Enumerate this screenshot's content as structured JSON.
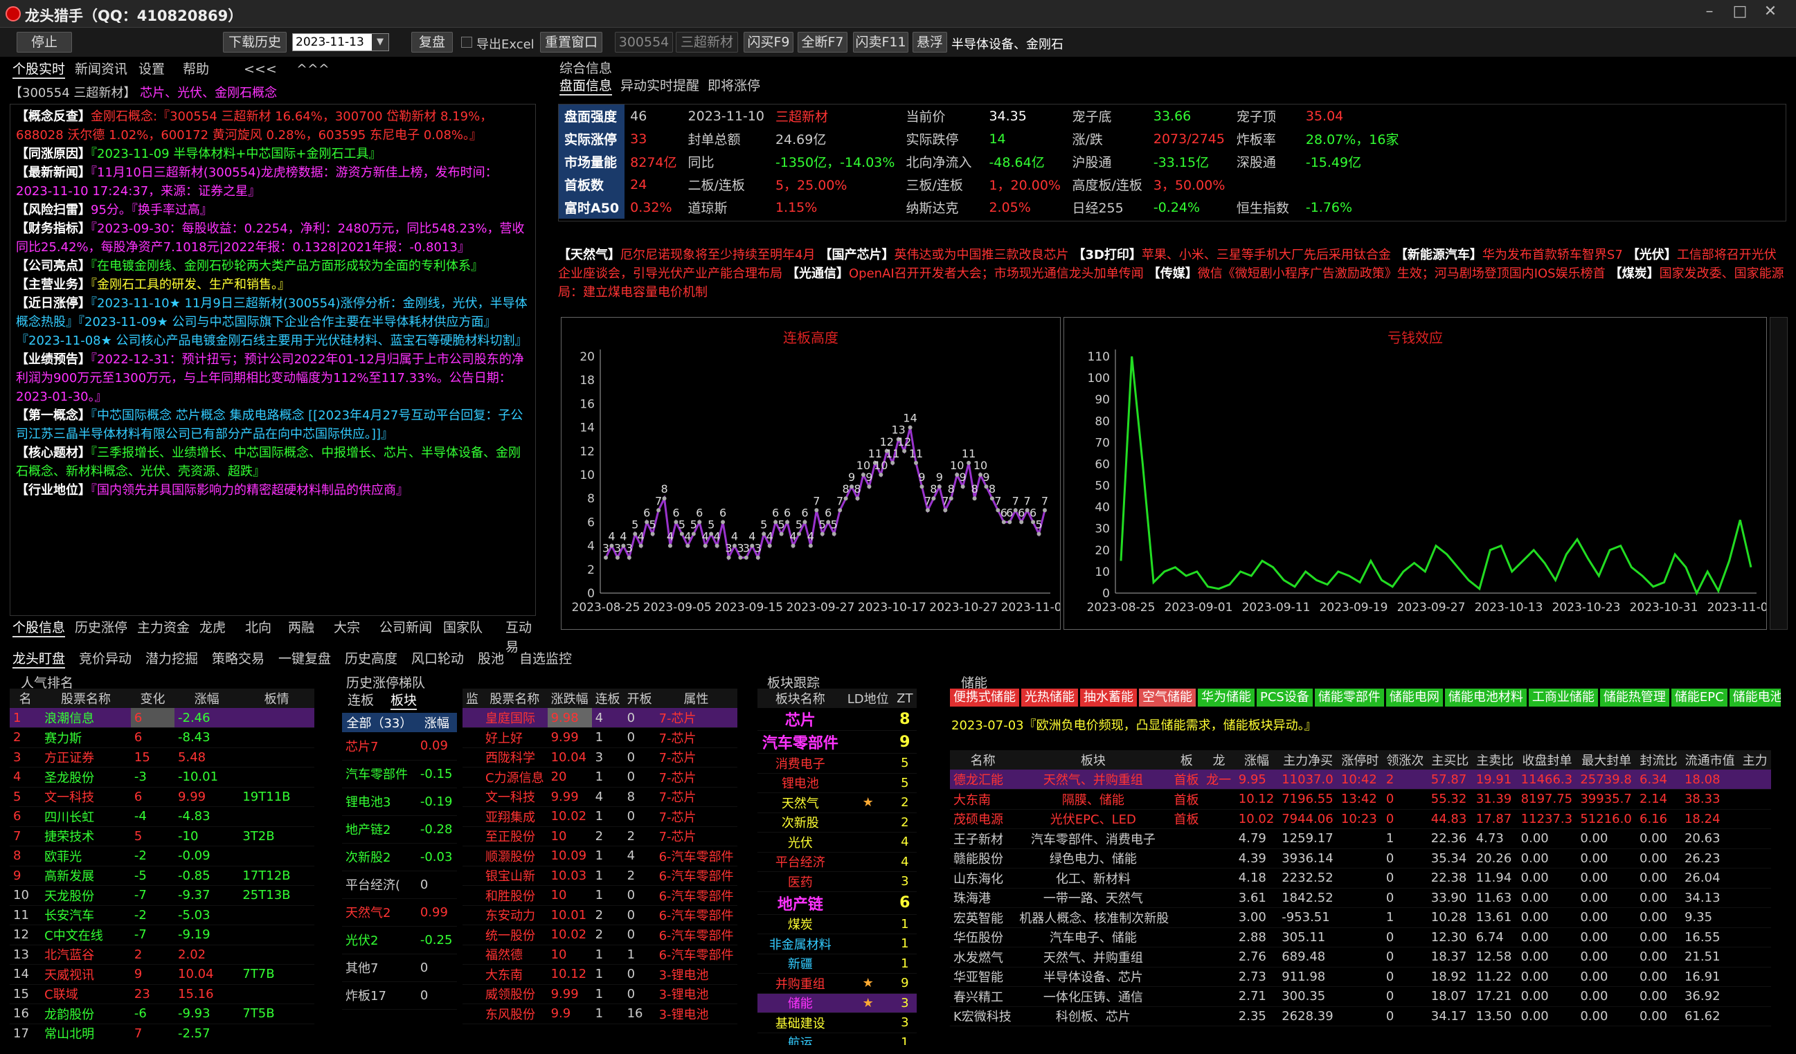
{
  "window": {
    "title": "龙头猎手（QQ：410820869）",
    "min": "–",
    "max": "□",
    "close": "✕"
  },
  "toolbar": {
    "stop": "停止",
    "download": "下载历史",
    "date": "2023-11-13",
    "replay": "复盘",
    "export": "导出Excel",
    "reset": "重置窗口",
    "code": "300554",
    "name": "三超新材",
    "flash_buy": "闪买F9",
    "full_sell": "全断F7",
    "flash_sell": "闪卖F11",
    "float": "悬浮",
    "concept": "半导体设备、金刚石"
  },
  "left_tabs": [
    "个股实时",
    "新闻资讯",
    "设置",
    "帮助",
    "<<<",
    "^^^"
  ],
  "stock_header": {
    "code_name": "【300554 三超新材】",
    "tags": "芯片、光伏、金刚石概念"
  },
  "info_lines": [
    {
      "label": "【概念反查】",
      "text": "金刚石概念:『300554 三超新材 16.64%，300700 岱勒新材 8.19%，688028 沃尔德 1.02%，600172 黄河旋风 0.28%，603595 东尼电子 0.08%。』",
      "cls": "r"
    },
    {
      "label": "【同涨原因】",
      "text": "『2023-11-09 半导体材料+中芯国际+金刚石工具』",
      "cls": "g"
    },
    {
      "label": "【最新新闻】",
      "text": "『11月10日三超新材(300554)龙虎榜数据：游资方新佳上榜，发布时间：2023-11-10 17:24:37，来源：证券之星』",
      "cls": "m"
    },
    {
      "label": "【风险扫雷】",
      "text": "95分。『换手率过高』",
      "cls": "m"
    },
    {
      "label": "【财务指标】",
      "text": "『2023-09-30：每股收益：0.2254，净利：2480万元，同比548.23%，营收同比25.42%，每股净资产7.1018元|2022年报：0.1328|2021年报：-0.8013』",
      "cls": "m"
    },
    {
      "label": "【公司亮点】",
      "text": "『在电镀金刚线、金刚石砂轮两大类产品方面形成较为全面的专利体系』",
      "cls": "g"
    },
    {
      "label": "【主营业务】",
      "text": "『金刚石工具的研发、生产和销售。』",
      "cls": "y"
    },
    {
      "label": "【近日涨停】",
      "text": "『2023-11-10★ 11月9日三超新材(300554)涨停分析：金刚线，光伏，半导体概念热股』『2023-11-09★ 公司与中芯国际旗下企业合作主要在半导体耗材供应方面』『2023-11-08★ 公司核心产品电镀金刚石线主要用于光伏硅材料、蓝宝石等硬脆材料切割』",
      "cls": "c"
    },
    {
      "label": "【业绩预告】",
      "text": "『2022-12-31：预计扭亏；预计公司2022年01-12月归属于上市公司股东的净利润为900万元至1300万元，与上年同期相比变动幅度为112%至117.33%。公告日期：2023-01-30。』",
      "cls": "m"
    },
    {
      "label": "【第一概念】",
      "text": "『中芯国际概念 芯片概念 集成电路概念 [[2023年4月27号互动平台回复：子公司江苏三晶半导体材料有限公司已有部分产品在向中芯国际供应。]]』",
      "cls": "c"
    },
    {
      "label": "【核心题材】",
      "text": "『三季报增长、业绩增长、中芯国际概念、中报增长、芯片、半导体设备、金刚石概念、新材料概念、光伏、壳资源、超跌』",
      "cls": "g"
    },
    {
      "label": "【行业地位】",
      "text": "『国内领先并具国际影响力的精密超硬材料制品的供应商』",
      "cls": "m"
    }
  ],
  "left_bottom_tabs": [
    "个股信息",
    "历史涨停",
    "主力资金",
    "龙虎",
    "北向",
    "两融",
    "大宗",
    "公司新闻",
    "国家队",
    "互动易"
  ],
  "summary": {
    "title": "综合信息",
    "tabs": [
      "盘面信息",
      "异动实时提醒",
      "即将涨停"
    ]
  },
  "market": [
    [
      "盘面强度",
      "46",
      "2023-11-10",
      "三超新材",
      "当前价",
      "34.35",
      "宠子底",
      "33.66",
      "宠子顶",
      "35.04"
    ],
    [
      "实际涨停",
      "33",
      "封单总额",
      "24.69亿",
      "实际跌停",
      "14",
      "涨/跌",
      "2073/2745",
      "炸板率",
      "28.07%，16家"
    ],
    [
      "市场量能",
      "8274亿",
      "同比",
      "-1350亿，-14.03%",
      "北向净流入",
      "-48.64亿",
      "沪股通",
      "-33.15亿",
      "深股通",
      "-15.49亿"
    ],
    [
      "首板数",
      "24",
      "二板/连板",
      "5，25.00%",
      "三板/连板",
      "1，20.00%",
      "高度板/连板",
      "3，50.00%",
      "",
      ""
    ],
    [
      "富时A50",
      "0.32%",
      "道琼斯",
      "1.15%",
      "纳斯达克",
      "2.05%",
      "日经255",
      "-0.24%",
      "恒生指数",
      "-1.76%"
    ]
  ],
  "news": [
    {
      "k": "【天然气】",
      "v": "厄尔尼诺现象将至少持续至明年4月"
    },
    {
      "k": "【国产芯片】",
      "v": "英伟达或为中国推三款改良芯片"
    },
    {
      "k": "【3D打印】",
      "v": "苹果、小米、三星等手机大厂先后采用钛合金"
    },
    {
      "k": "【新能源汽车】",
      "v": "华为发布首款轿车智界S7"
    },
    {
      "k": "【光伏】",
      "v": "工信部将召开光伏企业座谈会，引导光伏产业产能合理布局"
    },
    {
      "k": "【光通信】",
      "v": "OpenAI召开开发者大会；市场现光通信龙头加单传闻"
    },
    {
      "k": "【传媒】",
      "v": "微信《微短剧小程序广告激励政策》生效；河马剧场登顶国内IOS娱乐榜首"
    },
    {
      "k": "【煤炭】",
      "v": "国家发改委、国家能源局：建立煤电容量电价机制"
    }
  ],
  "chart_data": [
    {
      "type": "line",
      "title": "连板高度",
      "x": [
        "2023-08-25",
        "2023-08-26",
        "2023-08-27",
        "2023-08-28",
        "2023-08-29",
        "2023-08-30",
        "2023-08-31",
        "2023-09-01",
        "2023-09-02",
        "2023-09-03",
        "2023-09-04",
        "2023-09-05",
        "2023-09-06",
        "2023-09-07",
        "2023-09-08",
        "2023-09-09",
        "2023-09-10",
        "2023-09-11",
        "2023-09-12",
        "2023-09-13",
        "2023-09-14",
        "2023-09-15",
        "2023-09-16",
        "2023-09-17",
        "2023-09-18",
        "2023-09-19",
        "2023-09-20",
        "2023-09-21",
        "2023-09-22",
        "2023-09-23",
        "2023-09-24",
        "2023-09-25",
        "2023-09-26",
        "2023-09-27",
        "2023-09-28",
        "2023-09-29",
        "2023-09-30",
        "2023-10-01",
        "2023-10-02",
        "2023-10-03",
        "2023-10-04",
        "2023-10-05",
        "2023-10-06",
        "2023-10-07",
        "2023-10-08",
        "2023-10-09",
        "2023-10-10",
        "2023-10-11",
        "2023-10-12",
        "2023-10-13",
        "2023-10-14",
        "2023-10-15",
        "2023-10-16",
        "2023-10-17",
        "2023-10-18",
        "2023-10-19",
        "2023-10-20",
        "2023-10-21",
        "2023-10-22",
        "2023-10-23",
        "2023-10-24",
        "2023-10-25",
        "2023-10-26",
        "2023-10-27",
        "2023-10-28",
        "2023-10-29",
        "2023-10-30",
        "2023-10-31",
        "2023-11-01",
        "2023-11-02",
        "2023-11-03",
        "2023-11-04",
        "2023-11-05",
        "2023-11-06",
        "2023-11-07",
        "2023-11-08"
      ],
      "values": [
        3,
        4,
        3,
        4,
        3,
        5,
        4,
        6,
        5,
        7,
        8,
        4,
        6,
        5,
        4,
        5,
        6,
        4,
        5,
        4,
        6,
        3,
        4,
        3,
        3,
        4,
        3,
        5,
        4,
        6,
        5,
        6,
        4,
        5,
        6,
        4,
        7,
        5,
        6,
        5,
        7,
        8,
        9,
        8,
        10,
        9,
        11,
        10,
        12,
        11,
        13,
        12,
        14,
        11,
        9,
        7,
        8,
        9,
        7,
        8,
        10,
        9,
        11,
        8,
        10,
        9,
        8,
        7,
        6,
        6,
        7,
        6,
        7,
        6,
        5,
        7
      ],
      "labels": [
        "3",
        "4",
        "3",
        "4",
        "3",
        "5",
        "4",
        "6",
        "5",
        "7",
        "8",
        "4",
        "6",
        "5",
        "4",
        "5",
        "6",
        "4",
        "5",
        "4",
        "6",
        "3",
        "4",
        "3",
        "3",
        "4",
        "3",
        "5",
        "4",
        "6",
        "5",
        "6",
        "4",
        "5",
        "6",
        "4",
        "7",
        "5",
        "6",
        "5",
        "7",
        "8",
        "9",
        "8",
        "10",
        "9",
        "11",
        "10",
        "12",
        "11",
        "13",
        "12",
        "14",
        "11",
        "9",
        "7",
        "8",
        "9",
        "7",
        "8",
        "10",
        "9",
        "11",
        "8",
        "10",
        "9",
        "8",
        "7",
        "6",
        "6",
        "7",
        "6",
        "7",
        "6",
        "5",
        "7"
      ],
      "ylim": [
        0,
        20
      ],
      "yticks": [
        "0",
        "2",
        "4",
        "6",
        "8",
        "10",
        "12",
        "14",
        "16",
        "18",
        "20"
      ],
      "xticks": [
        "2023-08-25",
        "2023-09-05",
        "2023-09-15",
        "2023-09-27",
        "2023-10-17",
        "2023-10-27",
        "2023-11-08"
      ],
      "color": "#9933cc"
    },
    {
      "type": "line",
      "title": "亏钱效应",
      "values": [
        15,
        110,
        60,
        5,
        10,
        12,
        8,
        10,
        3,
        2,
        4,
        10,
        8,
        15,
        12,
        6,
        3,
        10,
        6,
        4,
        10,
        8,
        5,
        15,
        6,
        3,
        10,
        14,
        10,
        22,
        18,
        12,
        6,
        2,
        20,
        22,
        10,
        15,
        20,
        14,
        6,
        18,
        25,
        16,
        8,
        20,
        22,
        12,
        8,
        3,
        5,
        18,
        12,
        0,
        10,
        1,
        15,
        34,
        12
      ],
      "ylim": [
        0,
        110
      ],
      "yticks": [
        "0",
        "10",
        "20",
        "30",
        "40",
        "50",
        "60",
        "70",
        "80",
        "90",
        "100",
        "110"
      ],
      "xticks": [
        "2023-08-25",
        "2023-09-01",
        "2023-09-11",
        "2023-09-19",
        "2023-09-27",
        "2023-10-13",
        "2023-10-23",
        "2023-10-31",
        "2023-11-08"
      ],
      "color": "#22dd22"
    }
  ],
  "bottom_tabs": [
    "龙头盯盘",
    "竞价异动",
    "潜力挖掘",
    "策略交易",
    "一键复盘",
    "历史高度",
    "风口轮动",
    "股池",
    "自选监控"
  ],
  "popular": {
    "title": "人气排名",
    "headers": [
      "名",
      "股票名称",
      "变化",
      "涨幅",
      "板情"
    ],
    "rows": [
      [
        "1",
        "浪潮信息",
        "6",
        "-2.46",
        ""
      ],
      [
        "2",
        "赛力斯",
        "6",
        "-8.43",
        ""
      ],
      [
        "3",
        "方正证券",
        "15",
        "5.48",
        ""
      ],
      [
        "4",
        "圣龙股份",
        "-3",
        "-10.01",
        ""
      ],
      [
        "5",
        "文一科技",
        "6",
        "9.99",
        "19T11B"
      ],
      [
        "6",
        "四川长虹",
        "-4",
        "-4.83",
        ""
      ],
      [
        "7",
        "捷荣技术",
        "5",
        "-10",
        "3T2B"
      ],
      [
        "8",
        "欧菲光",
        "-2",
        "-0.09",
        ""
      ],
      [
        "9",
        "高新发展",
        "-5",
        "-0.85",
        "17T12B"
      ],
      [
        "10",
        "天龙股份",
        "-7",
        "-9.37",
        "25T13B"
      ],
      [
        "11",
        "长安汽车",
        "-2",
        "-5.03",
        ""
      ],
      [
        "12",
        "C中文在线",
        "-7",
        "-9.19",
        ""
      ],
      [
        "13",
        "北汽蓝谷",
        "2",
        "2.02",
        ""
      ],
      [
        "14",
        "天威视讯",
        "9",
        "10.04",
        "7T7B"
      ],
      [
        "15",
        "C联域",
        "23",
        "15.16",
        ""
      ],
      [
        "16",
        "龙韵股份",
        "-6",
        "-9.93",
        "7T5B"
      ],
      [
        "17",
        "常山北明",
        "7",
        "-2.57",
        ""
      ]
    ]
  },
  "ladder": {
    "title": "历史涨停梯队",
    "tabs": [
      "连板",
      "板块"
    ],
    "headers": [
      "全部（33）",
      "涨幅"
    ],
    "rows": [
      [
        "芯片7",
        "0.09"
      ],
      [
        "汽车零部件",
        "-0.15"
      ],
      [
        "锂电池3",
        "-0.19"
      ],
      [
        "地产链2",
        "-0.28"
      ],
      [
        "次新股2",
        "-0.03"
      ],
      [
        "平台经济(",
        "0"
      ],
      [
        "天然气2",
        "0.99"
      ],
      [
        "光伏2",
        "-0.25"
      ],
      [
        "其他7",
        "0"
      ],
      [
        "炸板17",
        "0"
      ]
    ]
  },
  "limitup": {
    "headers": [
      "监",
      "股票名称",
      "涨跌幅",
      "连板",
      "开板",
      "属性"
    ],
    "rows": [
      [
        "",
        "皇庭国际",
        "9.98",
        "4",
        "0",
        "7-芯片"
      ],
      [
        "",
        "好上好",
        "9.99",
        "1",
        "0",
        "7-芯片"
      ],
      [
        "",
        "西陇科学",
        "10.04",
        "3",
        "0",
        "7-芯片"
      ],
      [
        "",
        "C力源信息",
        "20",
        "1",
        "0",
        "7-芯片"
      ],
      [
        "",
        "文一科技",
        "9.99",
        "4",
        "8",
        "7-芯片"
      ],
      [
        "",
        "亚翔集成",
        "10.02",
        "1",
        "0",
        "7-芯片"
      ],
      [
        "",
        "至正股份",
        "10",
        "2",
        "2",
        "7-芯片"
      ],
      [
        "",
        "顺灏股份",
        "10.09",
        "1",
        "4",
        "6-汽车零部件"
      ],
      [
        "",
        "银宝山新",
        "10.03",
        "1",
        "2",
        "6-汽车零部件"
      ],
      [
        "",
        "和胜股份",
        "10",
        "1",
        "0",
        "6-汽车零部件"
      ],
      [
        "",
        "东安动力",
        "10.01",
        "2",
        "0",
        "6-汽车零部件"
      ],
      [
        "",
        "统一股份",
        "10.02",
        "2",
        "0",
        "6-汽车零部件"
      ],
      [
        "",
        "福然德",
        "10",
        "1",
        "1",
        "6-汽车零部件"
      ],
      [
        "",
        "大东南",
        "10.12",
        "1",
        "0",
        "3-锂电池"
      ],
      [
        "",
        "威领股份",
        "9.99",
        "1",
        "0",
        "3-锂电池"
      ],
      [
        "",
        "东风股份",
        "9.9",
        "1",
        "16",
        "3-锂电池"
      ]
    ]
  },
  "sector": {
    "title": "板块跟踪",
    "headers": [
      "板块名称",
      "LD地位",
      "ZT"
    ],
    "rows": [
      [
        "芯片",
        "",
        "8"
      ],
      [
        "汽车零部件",
        "",
        "9"
      ],
      [
        "消费电子",
        "",
        "5"
      ],
      [
        "锂电池",
        "",
        "5"
      ],
      [
        "天然气",
        "★",
        "2"
      ],
      [
        "次新股",
        "",
        "2"
      ],
      [
        "光伏",
        "",
        "4"
      ],
      [
        "平台经济",
        "",
        "4"
      ],
      [
        "医药",
        "",
        "3"
      ],
      [
        "地产链",
        "",
        "6"
      ],
      [
        "煤炭",
        "",
        "1"
      ],
      [
        "非金属材料",
        "",
        "1"
      ],
      [
        "新疆",
        "",
        "1"
      ],
      [
        "并购重组",
        "★",
        "9"
      ],
      [
        "储能",
        "★",
        "3"
      ],
      [
        "基础建设",
        "",
        "3"
      ],
      [
        "航运",
        "",
        "1"
      ]
    ]
  },
  "energy": {
    "title": "储能",
    "tags": [
      "便携式储能",
      "光热储能",
      "抽水蓄能",
      "空气储能",
      "华为储能",
      "PCS设备",
      "储能零部件",
      "储能电网",
      "储能电池材料",
      "工商业储能",
      "储能热管理",
      "储能EPC",
      "储能电池厂商"
    ],
    "tag_colors": [
      "#e03030",
      "#e03030",
      "#e03030",
      "#e05050",
      "#22bb22",
      "#22bb22",
      "#22bb22",
      "#22bb22",
      "#22bb22",
      "#22bb22",
      "#22bb22",
      "#22bb22",
      "#22bb22"
    ],
    "news": "2023-07-03『欧洲负电价频现，凸显储能需求，储能板块异动。』",
    "headers": [
      "名称",
      "板块",
      "板",
      "龙",
      "涨幅",
      "主力净买",
      "涨停时",
      "领涨次",
      "主买比",
      "主卖比",
      "收盘封单",
      "最大封单",
      "封流比",
      "流通市值",
      "主力"
    ],
    "rows": [
      [
        "德龙汇能",
        "天然气、并购重组",
        "首板",
        "龙一",
        "9.95",
        "11037.0",
        "10:42",
        "2",
        "57.87",
        "19.91",
        "11466.3",
        "25739.8",
        "6.34",
        "18.08",
        ""
      ],
      [
        "大东南",
        "隔膜、储能",
        "首板",
        "",
        "10.12",
        "7196.55",
        "13:42",
        "0",
        "55.32",
        "31.39",
        "8197.75",
        "39935.7",
        "2.14",
        "38.33",
        ""
      ],
      [
        "茂硕电源",
        "光伏EPC、LED",
        "首板",
        "",
        "10.02",
        "7944.06",
        "10:23",
        "0",
        "44.83",
        "17.87",
        "11237.3",
        "51216.0",
        "6.16",
        "18.24",
        ""
      ],
      [
        "王子新材",
        "汽车零部件、消费电子",
        "",
        "",
        "4.79",
        "1259.17",
        "",
        "1",
        "22.36",
        "4.73",
        "0.00",
        "0.00",
        "0.00",
        "20.63",
        ""
      ],
      [
        "赣能股份",
        "绿色电力、储能",
        "",
        "",
        "4.39",
        "3936.14",
        "",
        "0",
        "35.34",
        "20.26",
        "0.00",
        "0.00",
        "0.00",
        "26.23",
        ""
      ],
      [
        "山东海化",
        "化工、新材料",
        "",
        "",
        "4.18",
        "2232.52",
        "",
        "0",
        "22.38",
        "11.94",
        "0.00",
        "0.00",
        "0.00",
        "26.04",
        ""
      ],
      [
        "珠海港",
        "一带一路、天然气",
        "",
        "",
        "3.61",
        "1842.52",
        "",
        "0",
        "33.90",
        "11.63",
        "0.00",
        "0.00",
        "0.00",
        "34.13",
        ""
      ],
      [
        "宏英智能",
        "机器人概念、核准制次新股",
        "",
        "",
        "3.00",
        "-953.51",
        "",
        "1",
        "10.28",
        "13.61",
        "0.00",
        "0.00",
        "0.00",
        "9.35",
        ""
      ],
      [
        "华伍股份",
        "汽车电子、储能",
        "",
        "",
        "2.88",
        "305.11",
        "",
        "0",
        "12.30",
        "6.74",
        "0.00",
        "0.00",
        "0.00",
        "16.55",
        ""
      ],
      [
        "水发燃气",
        "天然气、并购重组",
        "",
        "",
        "2.76",
        "689.48",
        "",
        "0",
        "18.37",
        "12.58",
        "0.00",
        "0.00",
        "0.00",
        "21.51",
        ""
      ],
      [
        "华亚智能",
        "半导体设备、芯片",
        "",
        "",
        "2.73",
        "911.98",
        "",
        "0",
        "18.92",
        "11.22",
        "0.00",
        "0.00",
        "0.00",
        "16.91",
        ""
      ],
      [
        "春兴精工",
        "一体化压铸、通信",
        "",
        "",
        "2.71",
        "300.35",
        "",
        "0",
        "18.07",
        "17.21",
        "0.00",
        "0.00",
        "0.00",
        "36.92",
        ""
      ],
      [
        "K宏微科技",
        "科创板、芯片",
        "",
        "",
        "2.35",
        "2628.39",
        "",
        "0",
        "34.17",
        "13.50",
        "0.00",
        "0.00",
        "0.00",
        "61.62",
        ""
      ]
    ]
  }
}
